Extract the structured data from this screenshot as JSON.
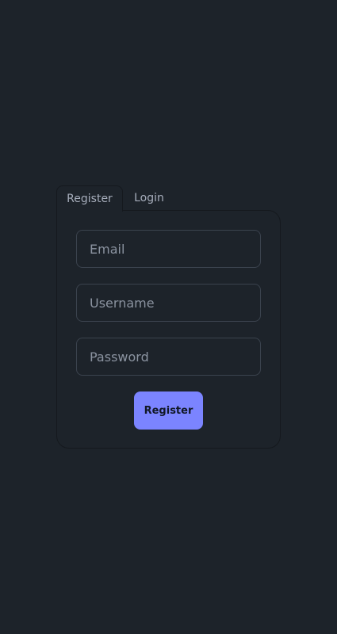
{
  "tabs": {
    "register_label": "Register",
    "login_label": "Login"
  },
  "form": {
    "email_placeholder": "Email",
    "username_placeholder": "Username",
    "password_placeholder": "Password",
    "submit_label": "Register"
  },
  "colors": {
    "background": "#1d232a",
    "accent": "#7b84ff",
    "text_muted": "#a6adbb"
  }
}
